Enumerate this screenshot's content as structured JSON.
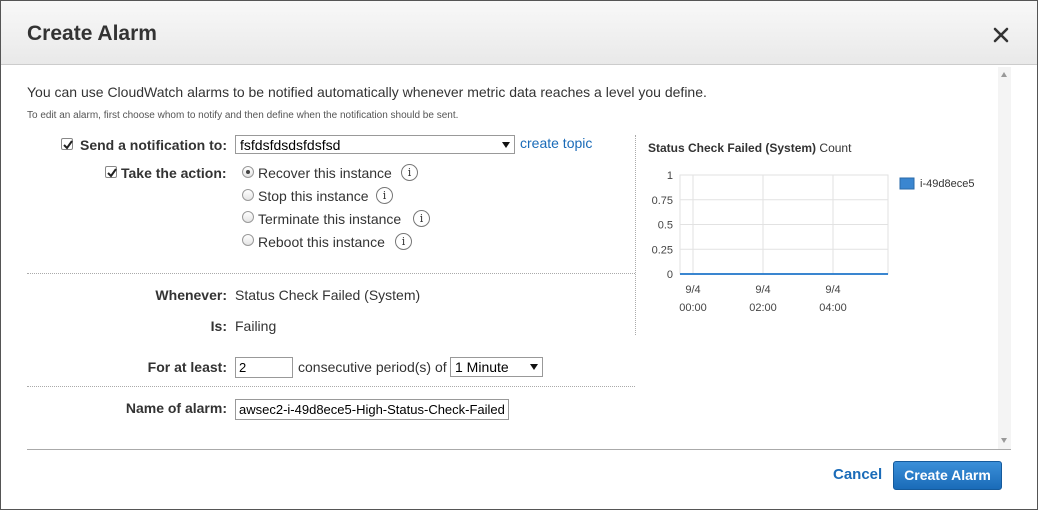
{
  "dialog": {
    "title": "Create Alarm",
    "intro": "You can use CloudWatch alarms to be notified automatically whenever metric data reaches a level you define.",
    "subintro": "To edit an alarm, first choose whom to notify and then define when the notification should be sent."
  },
  "notification": {
    "label": "Send a notification to:",
    "checked": true,
    "topic_value": "fsfdsfdsdsfdsfsd",
    "create_topic_link": "create topic"
  },
  "action": {
    "label": "Take the action:",
    "checked": true,
    "options": [
      {
        "label": "Recover this instance",
        "selected": true
      },
      {
        "label": "Stop this instance",
        "selected": false
      },
      {
        "label": "Terminate this instance",
        "selected": false
      },
      {
        "label": "Reboot this instance",
        "selected": false
      }
    ],
    "info_glyph": "i"
  },
  "condition": {
    "whenever_label": "Whenever:",
    "whenever_value": "Status Check Failed (System)",
    "is_label": "Is:",
    "is_value": "Failing",
    "for_label": "For at least:",
    "periods_value": "2",
    "periods_text": "consecutive period(s) of",
    "period_unit": "1 Minute",
    "name_label": "Name of alarm:",
    "name_value": "awsec2-i-49d8ece5-High-Status-Check-Failed"
  },
  "footer": {
    "cancel_label": "Cancel",
    "create_label": "Create Alarm"
  },
  "colors": {
    "link": "#1a6bb8",
    "primary_button": "#1a6bb8",
    "series": "#3a86d0"
  },
  "chart_data": {
    "type": "line",
    "title": "Status Check Failed (System)",
    "title_suffix": "Count",
    "yticks": [
      "1",
      "0.75",
      "0.5",
      "0.25",
      "0"
    ],
    "ylim": [
      0,
      1
    ],
    "xticks": [
      {
        "date": "9/4",
        "time": "00:00"
      },
      {
        "date": "9/4",
        "time": "02:00"
      },
      {
        "date": "9/4",
        "time": "04:00"
      }
    ],
    "series": [
      {
        "name": "i-49d8ece5",
        "values": [
          0,
          0,
          0,
          0
        ]
      }
    ],
    "grid": true,
    "legend": "right"
  }
}
